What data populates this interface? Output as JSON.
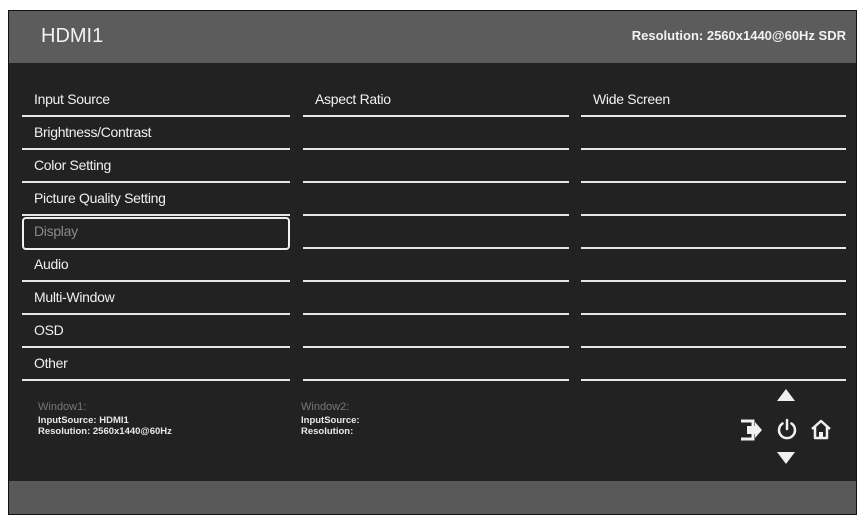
{
  "header": {
    "title": "HDMI1",
    "resolution": "Resolution: 2560x1440@60Hz SDR"
  },
  "menu": {
    "items": [
      {
        "label": "Input Source"
      },
      {
        "label": "Brightness/Contrast"
      },
      {
        "label": "Color Setting"
      },
      {
        "label": "Picture Quality Setting"
      },
      {
        "label": "Display"
      },
      {
        "label": "Audio"
      },
      {
        "label": "Multi-Window"
      },
      {
        "label": "OSD"
      },
      {
        "label": "Other"
      }
    ],
    "selected": "Display"
  },
  "submenu": {
    "column2_first": "Aspect Ratio",
    "column3_first": "Wide Screen"
  },
  "window1": {
    "title": "Window1:",
    "input_source": "InputSource: HDMI1",
    "resolution": "Resolution: 2560x1440@60Hz"
  },
  "window2": {
    "title": "Window2:",
    "input_source": "InputSource:",
    "resolution": "Resolution:"
  },
  "nav_icons": [
    "up-arrow-icon",
    "exit-icon",
    "power-icon",
    "home-icon",
    "down-arrow-icon"
  ],
  "colors": {
    "background": "#222222",
    "header": "#5c5c5c",
    "text": "#f0f0f0",
    "selected_text": "#8a8a8a"
  }
}
